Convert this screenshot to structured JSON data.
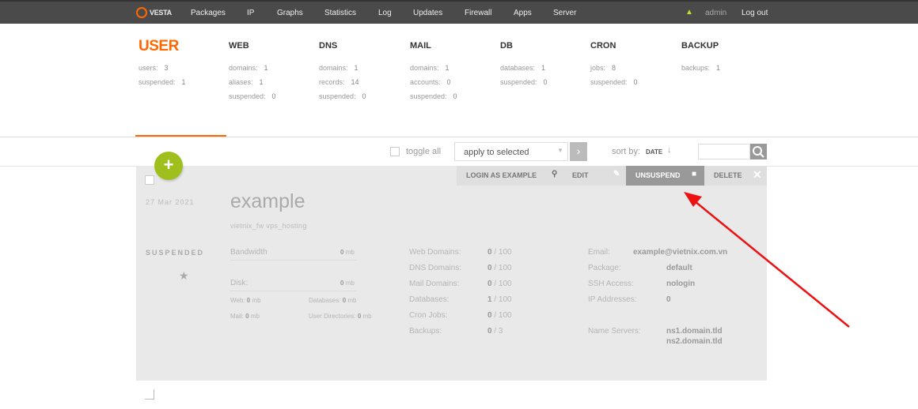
{
  "topbar": {
    "logo": "VESTA",
    "nav": [
      "Packages",
      "IP",
      "Graphs",
      "Statistics",
      "Log",
      "Updates",
      "Firewall",
      "Apps",
      "Server"
    ],
    "user": "admin",
    "logout": "Log out"
  },
  "stats": {
    "user": {
      "title": "USER",
      "users_label": "users:",
      "users": "3",
      "suspended_label": "suspended:",
      "suspended": "1"
    },
    "web": {
      "title": "WEB",
      "domains_label": "domains:",
      "domains": "1",
      "aliases_label": "aliases:",
      "aliases": "1",
      "suspended_label": "suspended:",
      "suspended": "0"
    },
    "dns": {
      "title": "DNS",
      "domains_label": "domains:",
      "domains": "1",
      "records_label": "records:",
      "records": "14",
      "suspended_label": "suspended:",
      "suspended": "0"
    },
    "mail": {
      "title": "MAIL",
      "domains_label": "domains:",
      "domains": "1",
      "accounts_label": "accounts:",
      "accounts": "0",
      "suspended_label": "suspended:",
      "suspended": "0"
    },
    "db": {
      "title": "DB",
      "databases_label": "databases:",
      "databases": "1",
      "suspended_label": "suspended:",
      "suspended": "0"
    },
    "cron": {
      "title": "CRON",
      "jobs_label": "jobs:",
      "jobs": "8",
      "suspended_label": "suspended:",
      "suspended": "0"
    },
    "backup": {
      "title": "BACKUP",
      "backups_label": "backups:",
      "backups": "1"
    }
  },
  "toolbar": {
    "toggle_all": "toggle all",
    "apply_select": "apply to selected",
    "sort_by": "sort by:",
    "sort_value": "DATE",
    "sort_arrow": "↓"
  },
  "user_card": {
    "actions": [
      "LOGIN AS EXAMPLE",
      "EDIT",
      "UNSUSPEND",
      "DELETE"
    ],
    "date": "27  Mar  2021",
    "name": "example",
    "package": "vietnix_fw vps_hosting",
    "status": "SUSPENDED",
    "bandwidth_label": "Bandwidth",
    "bandwidth_value": "0",
    "disk_label": "Disk:",
    "disk_value": "0",
    "unit": "mb",
    "web_label": "Web:",
    "web_value": "0",
    "databases_label": "Databases:",
    "databases_value": "0",
    "mail_label": "Mail:",
    "mail_value": "0",
    "userdirs_label": "User Directories:",
    "userdirs_value": "0",
    "limits": [
      {
        "label": "Web Domains:",
        "used": "0",
        "max": "/ 100"
      },
      {
        "label": "DNS Domains:",
        "used": "0",
        "max": "/ 100"
      },
      {
        "label": "Mail Domains:",
        "used": "0",
        "max": "/ 100"
      },
      {
        "label": "Databases:",
        "used": "1",
        "max": "/ 100"
      },
      {
        "label": "Cron Jobs:",
        "used": "0",
        "max": "/ 100"
      },
      {
        "label": "Backups:",
        "used": "0",
        "max": "/ 3"
      }
    ],
    "info": {
      "email_label": "Email:",
      "email": "example@vietnix.com.vn",
      "package_label": "Package:",
      "package": "default",
      "ssh_label": "SSH Access:",
      "ssh": "nologin",
      "ip_label": "IP Addresses:",
      "ip": "0",
      "ns_label": "Name Servers:",
      "ns1": "ns1.domain.tld",
      "ns2": "ns2.domain.tld"
    }
  },
  "colors": {
    "accent": "#ff6701",
    "annotation_arrow": "#ee1111",
    "add_button": "#9fbf1c"
  }
}
